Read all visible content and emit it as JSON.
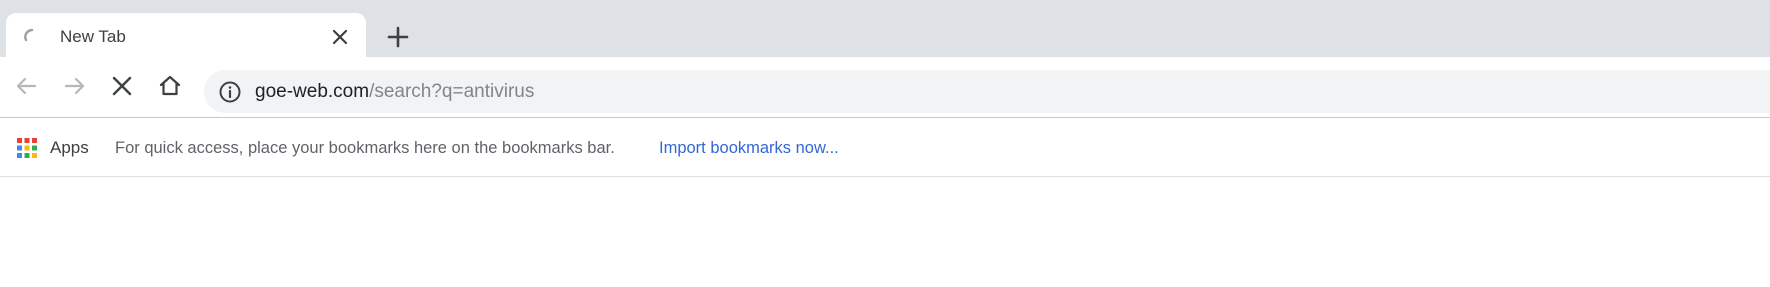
{
  "tab": {
    "title": "New Tab",
    "loading": true
  },
  "toolbar": {
    "back_icon": "arrow-left-icon",
    "forward_icon": "arrow-right-icon",
    "stop_icon": "close-icon",
    "home_icon": "home-icon"
  },
  "omnibox": {
    "info_icon": "info-icon",
    "url_host": "goe-web.com",
    "url_path": "/search?q=antivirus"
  },
  "bookmarks_bar": {
    "apps_label": "Apps",
    "hint": "For quick access, place your bookmarks here on the bookmarks bar.",
    "import_link": "Import bookmarks now..."
  },
  "colors": {
    "tabstrip_bg": "#dee1e6",
    "omnibox_bg": "#f1f3f4",
    "link": "#3367d6",
    "spinner": "#9aa0a6"
  }
}
